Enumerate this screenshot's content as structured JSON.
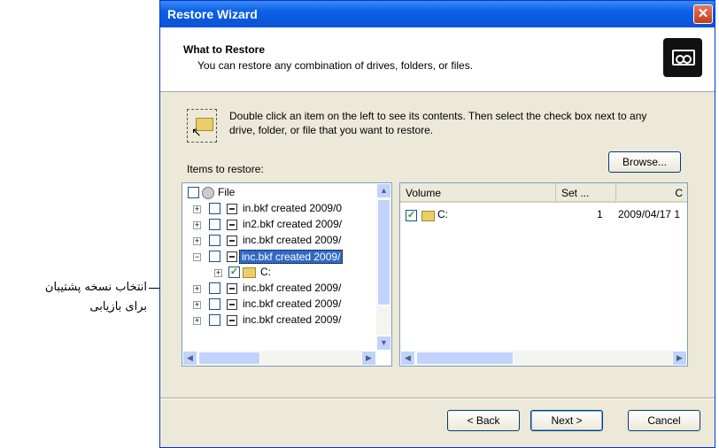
{
  "annotation": {
    "line1": "انتخاب نسخه پشتیبان",
    "line2": "برای بازیابی"
  },
  "window": {
    "title": "Restore Wizard",
    "close": "✕"
  },
  "header": {
    "title": "What to Restore",
    "subtitle": "You can restore any combination of drives, folders, or files."
  },
  "hint": {
    "text": "Double click an item on the left to see its contents. Then select the check box next to any drive, folder, or file that you want to restore."
  },
  "browse_button": "Browse...",
  "items_label": "Items to restore:",
  "tree": {
    "root": "File",
    "items": [
      {
        "label": "in.bkf created 2009/0",
        "checked": false
      },
      {
        "label": "in2.bkf created 2009/",
        "checked": false
      },
      {
        "label": "inc.bkf created 2009/",
        "checked": false
      },
      {
        "label": "inc.bkf created 2009/",
        "checked": false,
        "selected": true
      },
      {
        "label": "C:",
        "checked": true
      },
      {
        "label": "inc.bkf created 2009/",
        "checked": false
      },
      {
        "label": "inc.bkf created 2009/",
        "checked": false
      },
      {
        "label": "inc.bkf created 2009/",
        "checked": false
      }
    ]
  },
  "list": {
    "columns": [
      "Volume",
      "Set ...",
      "C"
    ],
    "rows": [
      {
        "volume": "C:",
        "set": "1",
        "created": "2009/04/17 1",
        "checked": true
      }
    ]
  },
  "buttons": {
    "back": "< Back",
    "next": "Next >",
    "cancel": "Cancel"
  },
  "check_glyph": "✓",
  "colors": {
    "title_bar": "#0a5ee8",
    "selection": "#316ac5",
    "dialog_bg": "#ece9d8"
  }
}
